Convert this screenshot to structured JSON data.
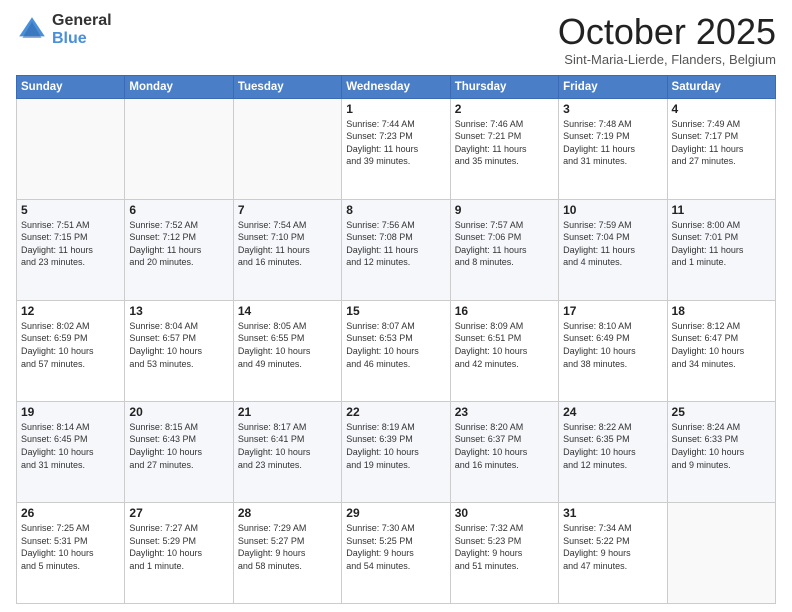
{
  "header": {
    "logo_general": "General",
    "logo_blue": "Blue",
    "month_title": "October 2025",
    "location": "Sint-Maria-Lierde, Flanders, Belgium"
  },
  "weekdays": [
    "Sunday",
    "Monday",
    "Tuesday",
    "Wednesday",
    "Thursday",
    "Friday",
    "Saturday"
  ],
  "weeks": [
    [
      {
        "day": "",
        "info": ""
      },
      {
        "day": "",
        "info": ""
      },
      {
        "day": "",
        "info": ""
      },
      {
        "day": "1",
        "info": "Sunrise: 7:44 AM\nSunset: 7:23 PM\nDaylight: 11 hours\nand 39 minutes."
      },
      {
        "day": "2",
        "info": "Sunrise: 7:46 AM\nSunset: 7:21 PM\nDaylight: 11 hours\nand 35 minutes."
      },
      {
        "day": "3",
        "info": "Sunrise: 7:48 AM\nSunset: 7:19 PM\nDaylight: 11 hours\nand 31 minutes."
      },
      {
        "day": "4",
        "info": "Sunrise: 7:49 AM\nSunset: 7:17 PM\nDaylight: 11 hours\nand 27 minutes."
      }
    ],
    [
      {
        "day": "5",
        "info": "Sunrise: 7:51 AM\nSunset: 7:15 PM\nDaylight: 11 hours\nand 23 minutes."
      },
      {
        "day": "6",
        "info": "Sunrise: 7:52 AM\nSunset: 7:12 PM\nDaylight: 11 hours\nand 20 minutes."
      },
      {
        "day": "7",
        "info": "Sunrise: 7:54 AM\nSunset: 7:10 PM\nDaylight: 11 hours\nand 16 minutes."
      },
      {
        "day": "8",
        "info": "Sunrise: 7:56 AM\nSunset: 7:08 PM\nDaylight: 11 hours\nand 12 minutes."
      },
      {
        "day": "9",
        "info": "Sunrise: 7:57 AM\nSunset: 7:06 PM\nDaylight: 11 hours\nand 8 minutes."
      },
      {
        "day": "10",
        "info": "Sunrise: 7:59 AM\nSunset: 7:04 PM\nDaylight: 11 hours\nand 4 minutes."
      },
      {
        "day": "11",
        "info": "Sunrise: 8:00 AM\nSunset: 7:01 PM\nDaylight: 11 hours\nand 1 minute."
      }
    ],
    [
      {
        "day": "12",
        "info": "Sunrise: 8:02 AM\nSunset: 6:59 PM\nDaylight: 10 hours\nand 57 minutes."
      },
      {
        "day": "13",
        "info": "Sunrise: 8:04 AM\nSunset: 6:57 PM\nDaylight: 10 hours\nand 53 minutes."
      },
      {
        "day": "14",
        "info": "Sunrise: 8:05 AM\nSunset: 6:55 PM\nDaylight: 10 hours\nand 49 minutes."
      },
      {
        "day": "15",
        "info": "Sunrise: 8:07 AM\nSunset: 6:53 PM\nDaylight: 10 hours\nand 46 minutes."
      },
      {
        "day": "16",
        "info": "Sunrise: 8:09 AM\nSunset: 6:51 PM\nDaylight: 10 hours\nand 42 minutes."
      },
      {
        "day": "17",
        "info": "Sunrise: 8:10 AM\nSunset: 6:49 PM\nDaylight: 10 hours\nand 38 minutes."
      },
      {
        "day": "18",
        "info": "Sunrise: 8:12 AM\nSunset: 6:47 PM\nDaylight: 10 hours\nand 34 minutes."
      }
    ],
    [
      {
        "day": "19",
        "info": "Sunrise: 8:14 AM\nSunset: 6:45 PM\nDaylight: 10 hours\nand 31 minutes."
      },
      {
        "day": "20",
        "info": "Sunrise: 8:15 AM\nSunset: 6:43 PM\nDaylight: 10 hours\nand 27 minutes."
      },
      {
        "day": "21",
        "info": "Sunrise: 8:17 AM\nSunset: 6:41 PM\nDaylight: 10 hours\nand 23 minutes."
      },
      {
        "day": "22",
        "info": "Sunrise: 8:19 AM\nSunset: 6:39 PM\nDaylight: 10 hours\nand 19 minutes."
      },
      {
        "day": "23",
        "info": "Sunrise: 8:20 AM\nSunset: 6:37 PM\nDaylight: 10 hours\nand 16 minutes."
      },
      {
        "day": "24",
        "info": "Sunrise: 8:22 AM\nSunset: 6:35 PM\nDaylight: 10 hours\nand 12 minutes."
      },
      {
        "day": "25",
        "info": "Sunrise: 8:24 AM\nSunset: 6:33 PM\nDaylight: 10 hours\nand 9 minutes."
      }
    ],
    [
      {
        "day": "26",
        "info": "Sunrise: 7:25 AM\nSunset: 5:31 PM\nDaylight: 10 hours\nand 5 minutes."
      },
      {
        "day": "27",
        "info": "Sunrise: 7:27 AM\nSunset: 5:29 PM\nDaylight: 10 hours\nand 1 minute."
      },
      {
        "day": "28",
        "info": "Sunrise: 7:29 AM\nSunset: 5:27 PM\nDaylight: 9 hours\nand 58 minutes."
      },
      {
        "day": "29",
        "info": "Sunrise: 7:30 AM\nSunset: 5:25 PM\nDaylight: 9 hours\nand 54 minutes."
      },
      {
        "day": "30",
        "info": "Sunrise: 7:32 AM\nSunset: 5:23 PM\nDaylight: 9 hours\nand 51 minutes."
      },
      {
        "day": "31",
        "info": "Sunrise: 7:34 AM\nSunset: 5:22 PM\nDaylight: 9 hours\nand 47 minutes."
      },
      {
        "day": "",
        "info": ""
      }
    ]
  ]
}
